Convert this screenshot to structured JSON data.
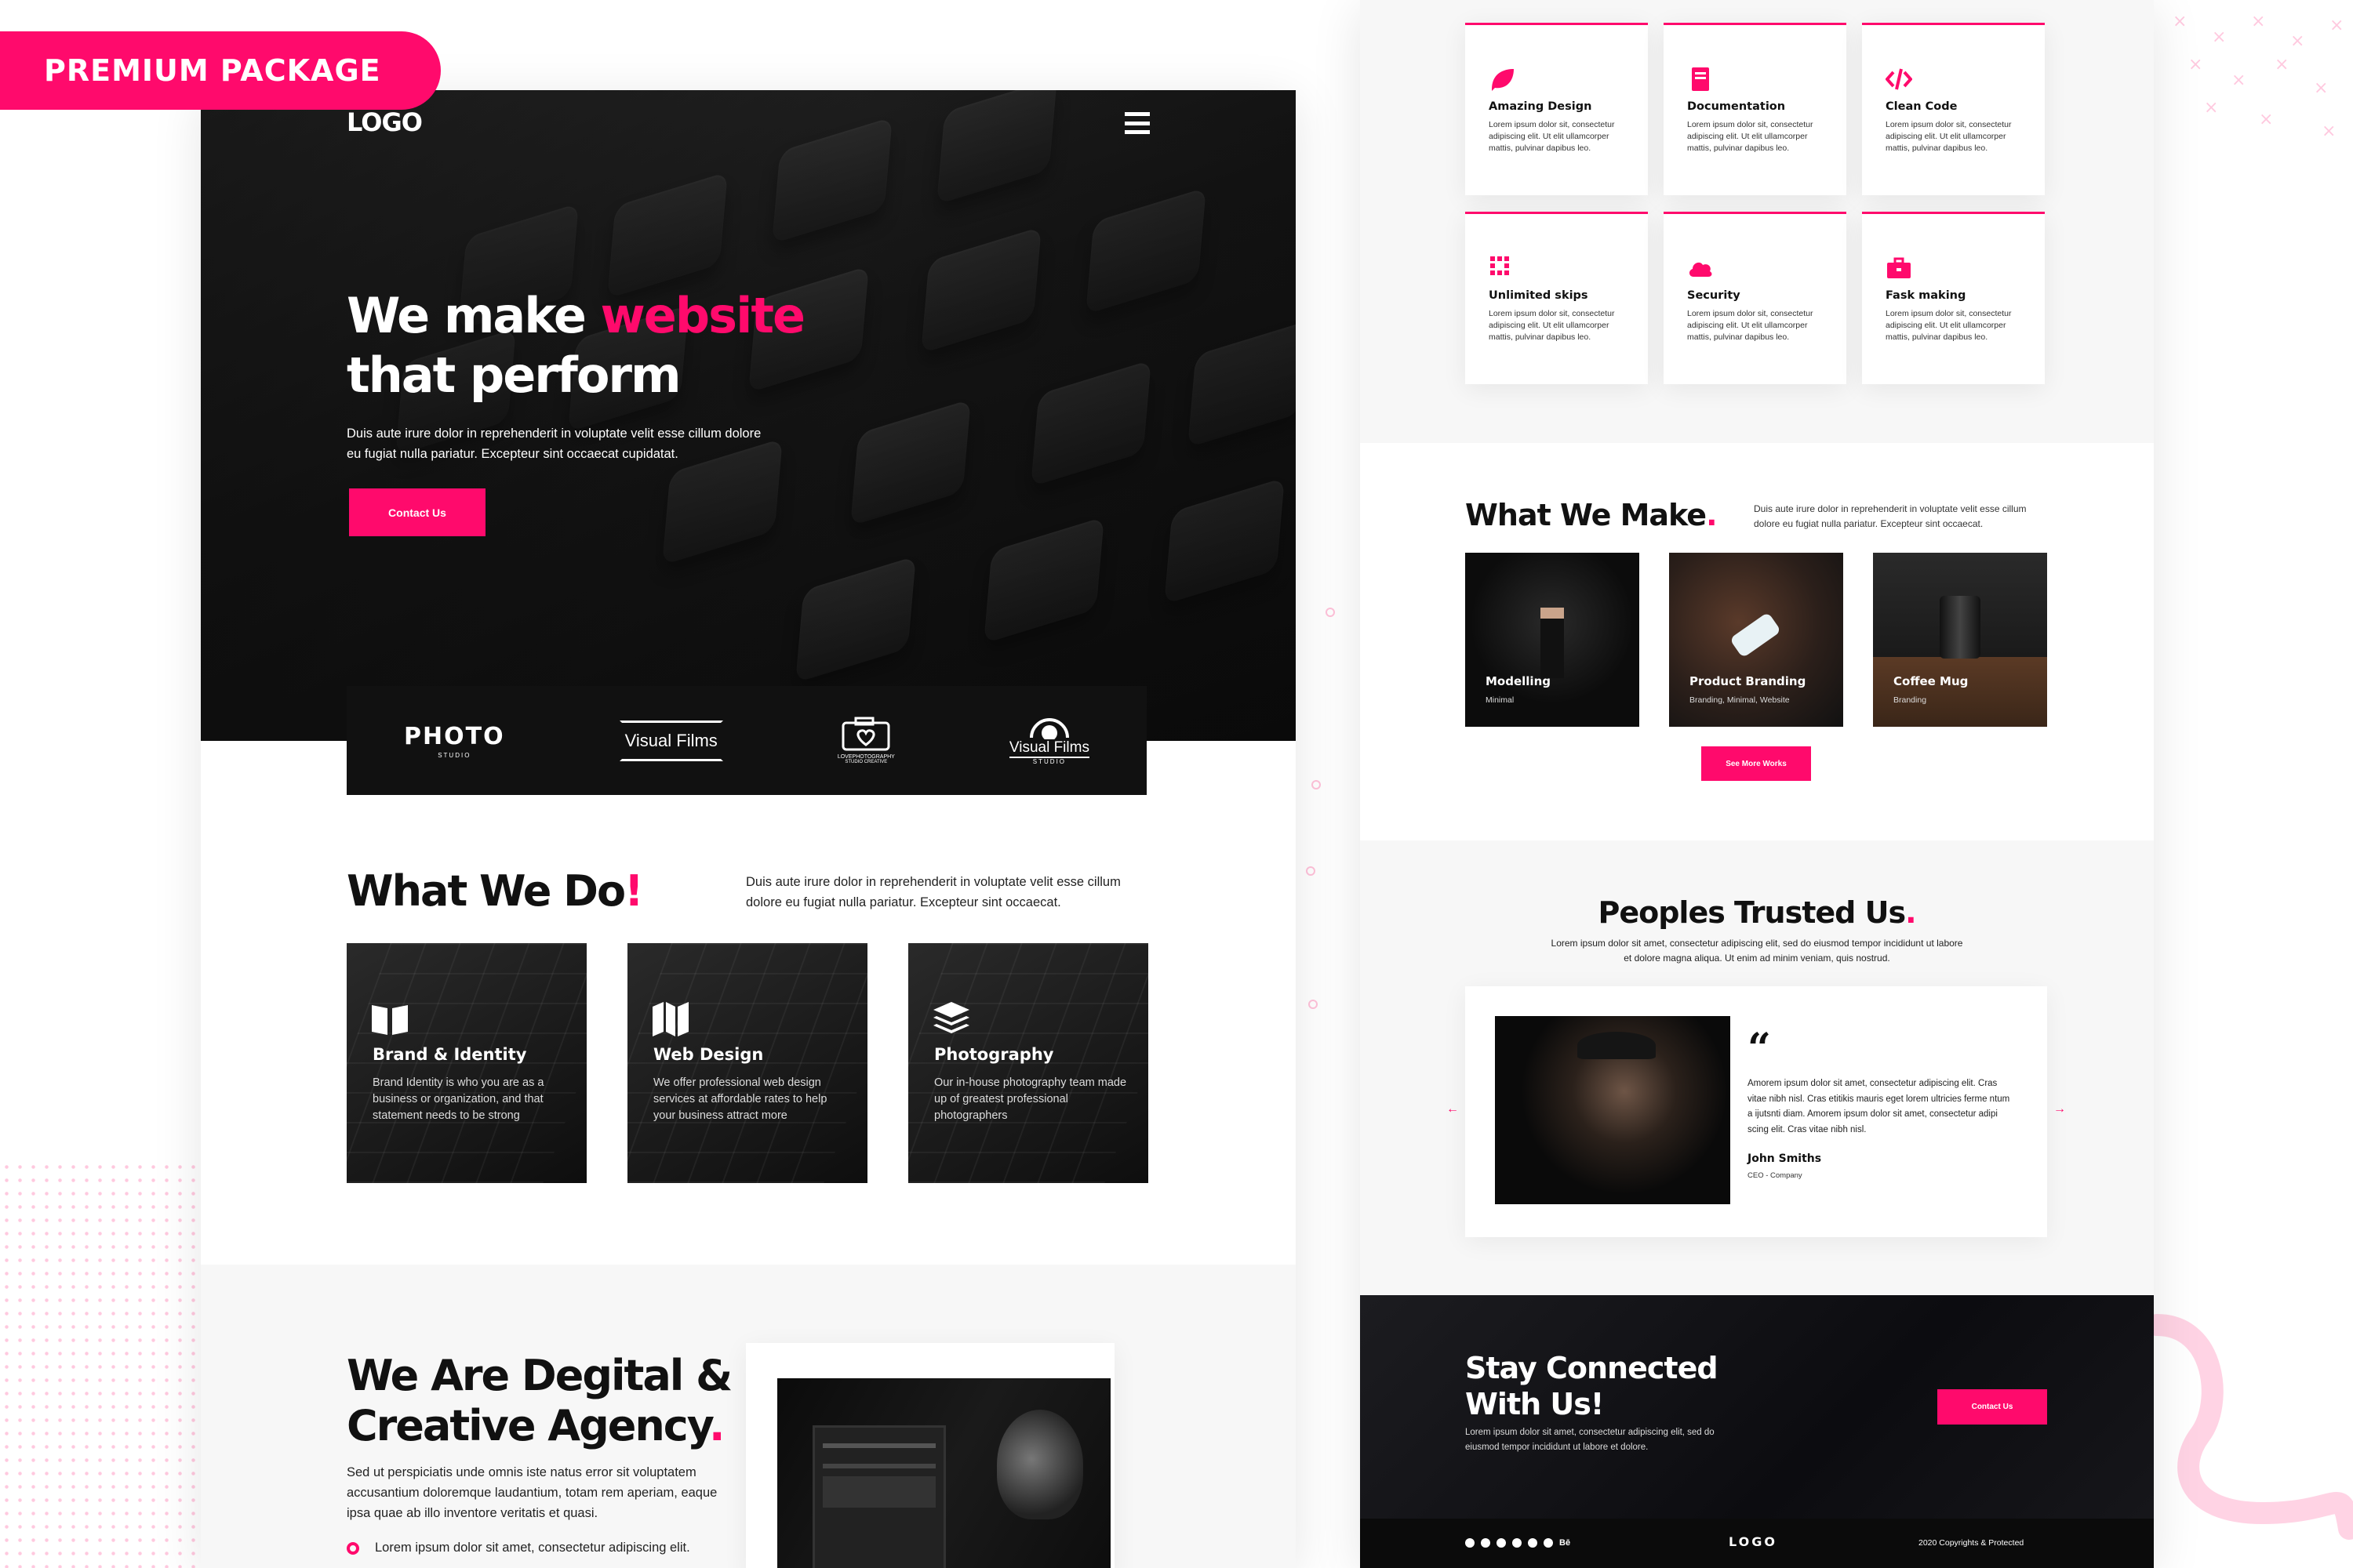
{
  "badge": "PREMIUM PACKAGE",
  "colors": {
    "accent": "#ff0a6c",
    "dark": "#111111"
  },
  "left": {
    "logo": "LOGO",
    "menu_icon": "hamburger-icon",
    "hero": {
      "title_part1": "We make ",
      "title_highlight": "website",
      "title_line2": "that perform",
      "text_line1": "Duis aute irure dolor in reprehenderit in voluptate velit esse cillum dolore",
      "text_line2": "eu fugiat nulla pariatur. Excepteur sint occaecat cupidatat.",
      "cta": "Contact Us"
    },
    "partner_logos": [
      {
        "name": "PHOTO",
        "sub": "STUDIO"
      },
      {
        "name": "Visual Films",
        "sub": ""
      },
      {
        "name": "LOVEPHOTOGRAPHY",
        "sub": "STUDIO CREATIVE"
      },
      {
        "name": "Visual Films",
        "sub": "STUDIO"
      }
    ],
    "what_we_do": {
      "title": "What We Do",
      "dot": "!",
      "text_line1": "Duis aute irure dolor in reprehenderit in voluptate velit esse cillum",
      "text_line2": "dolore eu fugiat nulla pariatur. Excepteur sint occaecat.",
      "services": [
        {
          "icon": "book-icon",
          "title": "Brand & Identity",
          "desc": "Brand Identity is who you are as a business or organization, and that statement needs to be strong"
        },
        {
          "icon": "map-icon",
          "title": "Web Design",
          "desc": "We offer professional web design services at affordable rates to help your business attract more"
        },
        {
          "icon": "layers-icon",
          "title": "Photography",
          "desc": "Our in-house photography team made up of greatest professional photographers"
        }
      ]
    },
    "agency": {
      "title_line1": "We Are Degital &",
      "title_line2": "Creative Agency",
      "dot": ".",
      "text": "Sed ut perspiciatis unde omnis iste natus error sit voluptatem accusantium doloremque laudantium, totam rem aperiam, eaque ipsa quae ab illo inventore veritatis et quasi.",
      "bullet": "Lorem ipsum dolor sit amet, consectetur adipiscing elit."
    }
  },
  "right": {
    "features": [
      {
        "icon": "leaf-icon",
        "title": "Amazing Design",
        "desc": "Lorem ipsum dolor sit, consectetur adipiscing elit. Ut elit ullamcorper mattis, pulvinar dapibus leo."
      },
      {
        "icon": "document-icon",
        "title": "Documentation",
        "desc": "Lorem ipsum dolor sit, consectetur adipiscing elit. Ut elit ullamcorper mattis, pulvinar dapibus leo."
      },
      {
        "icon": "code-icon",
        "title": "Clean Code",
        "desc": "Lorem ipsum dolor sit, consectetur adipiscing elit. Ut elit ullamcorper mattis, pulvinar dapibus leo."
      },
      {
        "icon": "grid-icon",
        "title": "Unlimited skips",
        "desc": "Lorem ipsum dolor sit, consectetur adipiscing elit. Ut elit ullamcorper mattis, pulvinar dapibus leo."
      },
      {
        "icon": "cloud-icon",
        "title": "Security",
        "desc": "Lorem ipsum dolor sit, consectetur adipiscing elit. Ut elit ullamcorper mattis, pulvinar dapibus leo."
      },
      {
        "icon": "briefcase-icon",
        "title": "Fask making",
        "desc": "Lorem ipsum dolor sit, consectetur adipiscing elit. Ut elit ullamcorper mattis, pulvinar dapibus leo."
      }
    ],
    "what_we_make": {
      "title": "What We Make",
      "dot": ".",
      "text": "Duis aute irure dolor in reprehenderit in voluptate velit esse cillum dolore eu fugiat nulla pariatur. Excepteur sint occaecat.",
      "works": [
        {
          "title": "Modelling",
          "sub": "Minimal"
        },
        {
          "title": "Product Branding",
          "sub": "Branding, Minimal, Website"
        },
        {
          "title": "Coffee Mug",
          "sub": "Branding"
        }
      ],
      "cta": "See More Works"
    },
    "trusted": {
      "title": "Peoples Trusted Us",
      "dot": ".",
      "text": "Lorem ipsum dolor sit amet, consectetur adipiscing elit, sed do eiusmod tempor incididunt ut labore et dolore magna aliqua. Ut enim ad minim veniam, quis nostrud.",
      "quote": "Amorem ipsum dolor sit amet, consectetur adipiscing elit. Cras vitae nibh nisl. Cras etitikis mauris eget lorem ultricies ferme ntum a ijutsnti diam. Amorem ipsum dolor sit amet, consectetur adipi scing elit. Cras vitae nibh nisl.",
      "name": "John Smiths",
      "role": "CEO - Company",
      "prev_icon": "arrow-left-icon",
      "next_icon": "arrow-right-icon"
    },
    "cta_section": {
      "title_line1": "Stay Connected",
      "title_line2": "With Us!",
      "text": "Lorem ipsum dolor sit amet, consectetur adipiscing elit, sed do eiusmod tempor incididunt ut labore et dolore.",
      "button": "Contact Us"
    },
    "footer": {
      "logo": "LOGO",
      "copyright": "2020 Copyrights & Protected",
      "social_icons": [
        "facebook-icon",
        "twitter-icon",
        "youtube-icon",
        "instagram-icon",
        "pinterest-icon",
        "dribbble-icon",
        "behance-icon"
      ],
      "behance_label": "Bē"
    }
  }
}
